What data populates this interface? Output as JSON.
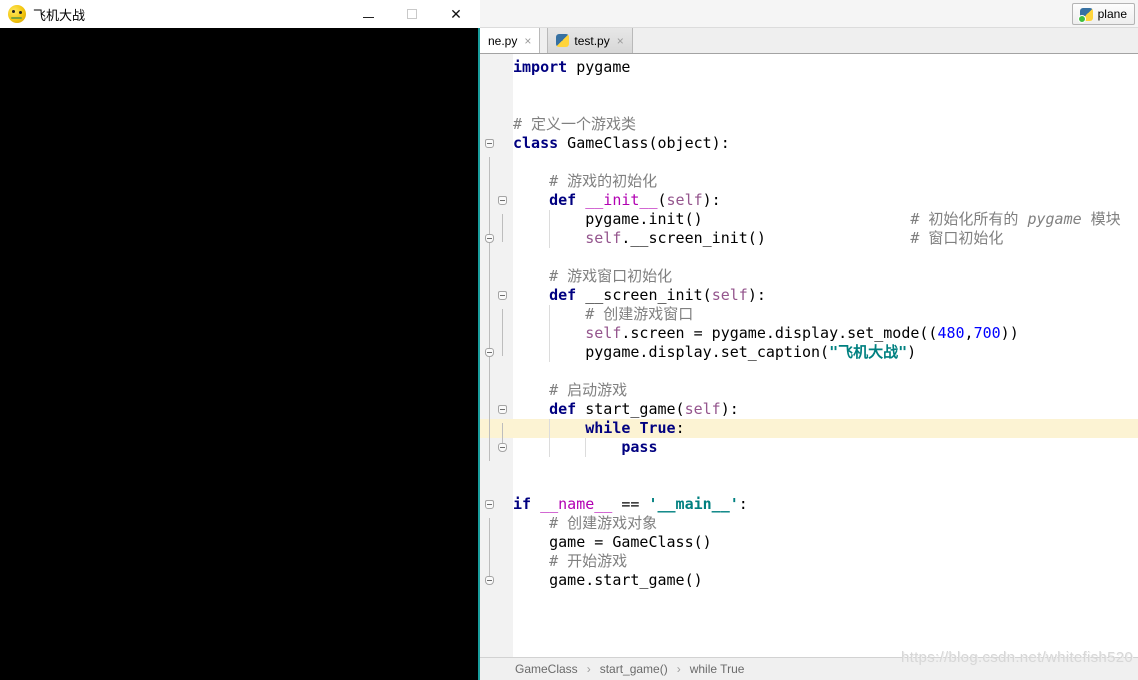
{
  "pygame_window": {
    "title": "飞机大战",
    "close_glyph": "✕"
  },
  "ide": {
    "run_button": {
      "label": "plane"
    },
    "tabs": [
      {
        "label": "ne.py",
        "active": true
      },
      {
        "label": "test.py",
        "active": false
      }
    ],
    "tab_close_glyph": "×",
    "breadcrumb_separator": "›",
    "breadcrumbs": [
      "GameClass",
      "start_game()",
      "while True"
    ],
    "watermark": "https://blog.csdn.net/whitefish520",
    "colors": {
      "keyword": "#000080",
      "comment": "#808080",
      "string": "#008080",
      "number": "#0000ff",
      "self": "#94558d",
      "dunder": "#b200b2",
      "caret_row": "#fcf3d3",
      "window_border": "#189c9c"
    },
    "code_lines": [
      {
        "seg": [
          [
            "k",
            "import"
          ],
          [
            "p",
            " pygame"
          ]
        ]
      },
      {
        "seg": []
      },
      {
        "seg": []
      },
      {
        "seg": [
          [
            "c",
            "# 定义一个游戏类"
          ]
        ]
      },
      {
        "g": "start",
        "gx": 5,
        "seg": [
          [
            "k",
            "class"
          ],
          [
            "p",
            " GameClass(object):"
          ]
        ]
      },
      {
        "seg": []
      },
      {
        "seg": [
          [
            "p",
            "    "
          ],
          [
            "c",
            "# 游戏的初始化"
          ]
        ]
      },
      {
        "g": "start",
        "gx": 18,
        "seg": [
          [
            "p",
            "    "
          ],
          [
            "k",
            "def"
          ],
          [
            "p",
            " "
          ],
          [
            "d",
            "__init__"
          ],
          [
            "p",
            "("
          ],
          [
            "s",
            "self"
          ],
          [
            "p",
            "):"
          ]
        ]
      },
      {
        "guides": [
          4
        ],
        "seg": [
          [
            "p",
            "        pygame.init()"
          ],
          [
            "p",
            "                       "
          ],
          [
            "c",
            "# 初始化所有的 "
          ],
          [
            "i",
            "pygame"
          ],
          [
            "c",
            " 模块"
          ]
        ]
      },
      {
        "g": "end",
        "gx": 5,
        "guides": [
          4
        ],
        "seg": [
          [
            "p",
            "        "
          ],
          [
            "s",
            "self"
          ],
          [
            "p",
            ".__screen_init()"
          ],
          [
            "p",
            "                "
          ],
          [
            "c",
            "# 窗口初始化"
          ]
        ]
      },
      {
        "seg": []
      },
      {
        "seg": [
          [
            "p",
            "    "
          ],
          [
            "c",
            "# 游戏窗口初始化"
          ]
        ]
      },
      {
        "g": "start",
        "gx": 18,
        "seg": [
          [
            "p",
            "    "
          ],
          [
            "k",
            "def"
          ],
          [
            "p",
            " __screen_init("
          ],
          [
            "s",
            "self"
          ],
          [
            "p",
            "):"
          ]
        ]
      },
      {
        "guides": [
          4
        ],
        "seg": [
          [
            "p",
            "        "
          ],
          [
            "c",
            "# 创建游戏窗口"
          ]
        ]
      },
      {
        "guides": [
          4
        ],
        "seg": [
          [
            "p",
            "        "
          ],
          [
            "s",
            "self"
          ],
          [
            "p",
            ".screen = pygame.display.set_mode(("
          ],
          [
            "n",
            "480"
          ],
          [
            "p",
            ","
          ],
          [
            "n",
            "700"
          ],
          [
            "p",
            "))"
          ]
        ]
      },
      {
        "g": "end",
        "gx": 5,
        "guides": [
          4
        ],
        "seg": [
          [
            "p",
            "        pygame.display.set_caption("
          ],
          [
            "t",
            "\"飞机大战\""
          ],
          [
            "p",
            ")"
          ]
        ]
      },
      {
        "seg": []
      },
      {
        "seg": [
          [
            "p",
            "    "
          ],
          [
            "c",
            "# 启动游戏"
          ]
        ]
      },
      {
        "g": "start",
        "gx": 18,
        "seg": [
          [
            "p",
            "    "
          ],
          [
            "k",
            "def"
          ],
          [
            "p",
            " start_game("
          ],
          [
            "s",
            "self"
          ],
          [
            "p",
            "):"
          ]
        ]
      },
      {
        "hl": true,
        "guides": [
          4
        ],
        "seg": [
          [
            "p",
            "        "
          ],
          [
            "k",
            "while"
          ],
          [
            "p",
            " "
          ],
          [
            "k",
            "True"
          ],
          [
            "p",
            ":"
          ]
        ]
      },
      {
        "g": "end",
        "gx": 18,
        "guides": [
          4,
          8
        ],
        "seg": [
          [
            "p",
            "            "
          ],
          [
            "k",
            "pass"
          ]
        ]
      },
      {
        "seg": []
      },
      {
        "seg": []
      },
      {
        "g": "start",
        "gx": 5,
        "seg": [
          [
            "k",
            "if"
          ],
          [
            "p",
            " "
          ],
          [
            "d",
            "__name__"
          ],
          [
            "p",
            " == "
          ],
          [
            "t",
            "'__main__'"
          ],
          [
            "p",
            ":"
          ]
        ]
      },
      {
        "seg": [
          [
            "p",
            "    "
          ],
          [
            "c",
            "# 创建游戏对象"
          ]
        ]
      },
      {
        "seg": [
          [
            "p",
            "    game = GameClass()"
          ]
        ]
      },
      {
        "seg": [
          [
            "p",
            "    "
          ],
          [
            "c",
            "# 开始游戏"
          ]
        ]
      },
      {
        "g": "end",
        "gx": 5,
        "seg": [
          [
            "p",
            "    game.start_game()"
          ]
        ]
      }
    ]
  }
}
